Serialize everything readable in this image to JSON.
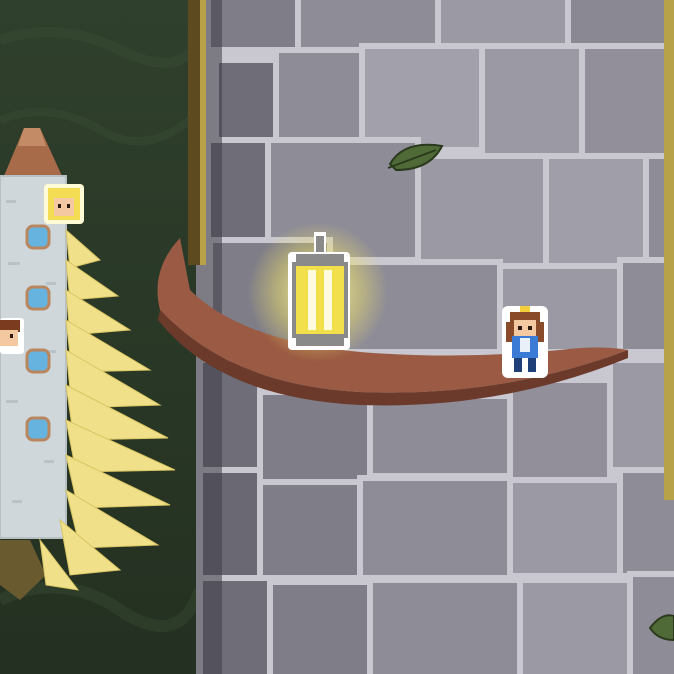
{
  "scene": {
    "kind": "game-viewport",
    "background_color": "#2e3d2a",
    "stone_colors": [
      "#8e8c97",
      "#7f7d88",
      "#9b99a4",
      "#6f6d78"
    ],
    "mortar_color": "#c9c7cf",
    "ledge_color": "#9a5a43",
    "wood_post_color": "#5d4a1f"
  },
  "sprites": {
    "lantern": {
      "name": "glowing-lantern",
      "glow_color": "#fff27a"
    },
    "princess": {
      "name": "princess-sprite",
      "hair_color": "#8a4b2a",
      "dress_color": "#3b7bd6"
    },
    "hud_character_blonde": {
      "name": "blonde-character-portrait",
      "hair_color": "#f2dd55"
    },
    "hud_character_brunette": {
      "name": "brunette-character-portrait",
      "hair_color": "#7a3b1f"
    },
    "mini_tower": {
      "name": "distant-tower",
      "roof_color": "#a86b4a",
      "window_color": "#66b3df"
    }
  },
  "decor": {
    "leaves": [
      "leaf",
      "leaf"
    ],
    "foliage_color": "#f0e08a"
  }
}
